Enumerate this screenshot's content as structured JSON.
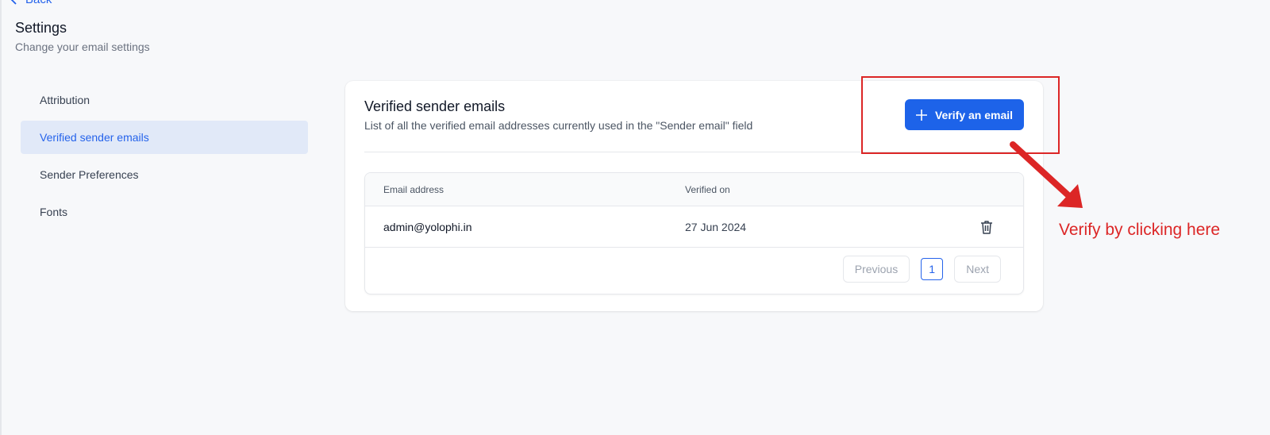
{
  "header": {
    "back_label": "Back",
    "title": "Settings",
    "subtitle": "Change your email settings"
  },
  "sidebar": {
    "items": [
      {
        "label": "Attribution",
        "active": false
      },
      {
        "label": "Verified sender emails",
        "active": true
      },
      {
        "label": "Sender Preferences",
        "active": false
      },
      {
        "label": "Fonts",
        "active": false
      }
    ]
  },
  "card": {
    "title": "Verified sender emails",
    "description": "List of all the verified email addresses currently used in the \"Sender email\" field",
    "verify_button_label": "Verify an email",
    "verify_button_icon": "plus-icon"
  },
  "table": {
    "columns": [
      "Email address",
      "Verified on"
    ],
    "rows": [
      {
        "email": "admin@yolophi.in",
        "verified_on": "27 Jun 2024",
        "action_icon": "trash-icon"
      }
    ]
  },
  "pagination": {
    "previous_label": "Previous",
    "current_page": "1",
    "next_label": "Next"
  },
  "annotation": {
    "text": "Verify by clicking here",
    "color": "#dc2626"
  },
  "colors": {
    "accent": "#1d63e9",
    "active_nav_bg": "#e1e9f8",
    "background": "#f7f8fa"
  }
}
